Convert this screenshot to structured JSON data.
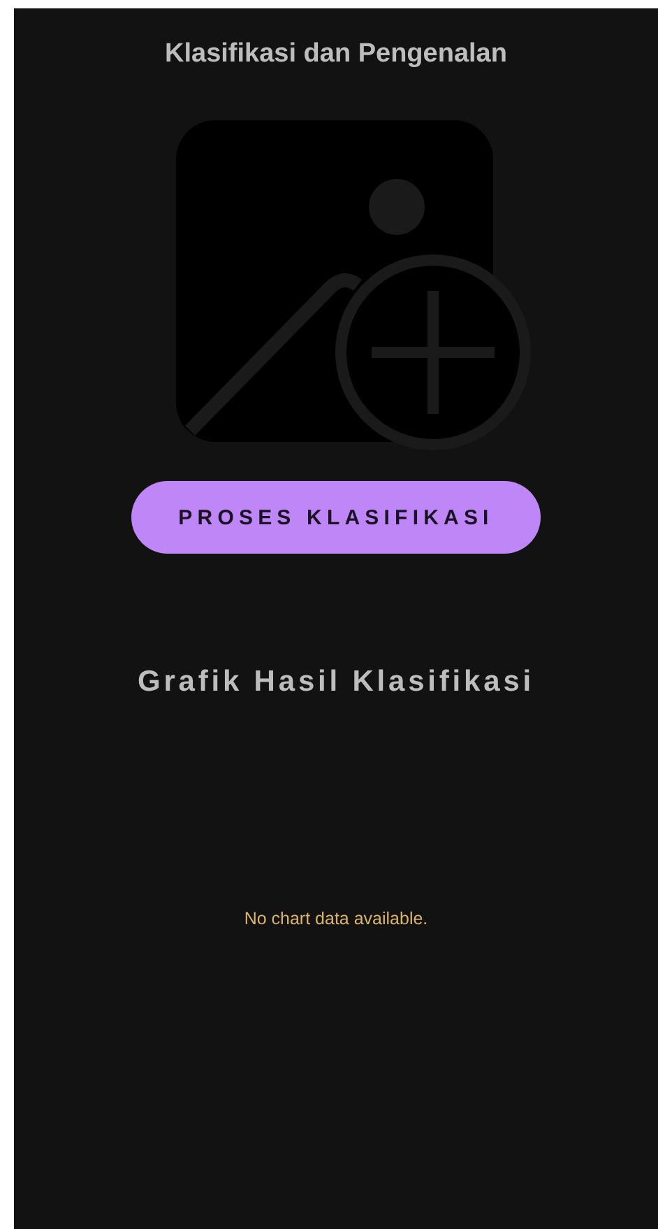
{
  "header": {
    "title": "Klasifikasi dan Pengenalan"
  },
  "image_picker": {
    "kind": "placeholder"
  },
  "process_button": {
    "label": "PROSES KLASIFIKASI"
  },
  "chart_section": {
    "title": "Grafik Hasil Klasifikasi",
    "empty_message": "No chart data available."
  }
}
